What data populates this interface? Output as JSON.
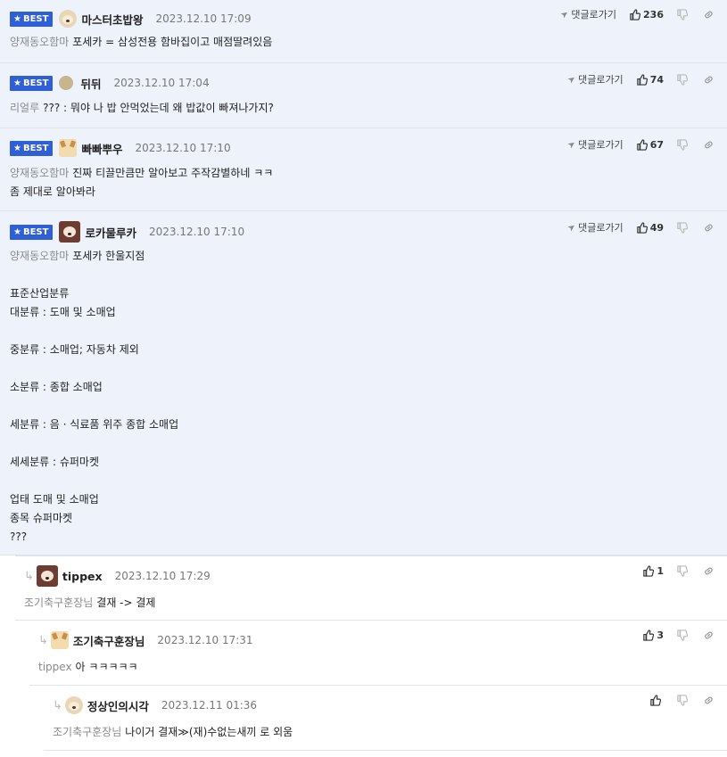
{
  "badge_label": "BEST",
  "action_labels": {
    "goto_reply": "댓글로가기"
  },
  "icons": {
    "goto": "paper-plane-icon",
    "like": "thumbs-up-icon",
    "dislike": "thumbs-down-icon",
    "link": "link-icon",
    "reply": "reply-arrow-icon",
    "best": "star-icon"
  },
  "colors": {
    "best_bg": "#eef2fb",
    "badge_bg": "#2f5fd6",
    "mention": "#8a8a8a"
  },
  "comments": [
    {
      "nick": "마스터초밥왕",
      "date": "2023.12.10 17:09",
      "likes": "236",
      "avatar": "puppy",
      "mention": "양재동오함마",
      "lines": [
        "포세카 = 삼성전용 함바집이고 매점딸려있음"
      ]
    },
    {
      "nick": "뒤뒤",
      "date": "2023.12.10 17:04",
      "likes": "74",
      "avatar": "dot",
      "mention": "리얼루",
      "lines": [
        "??? : 뭐야 나 밥 안먹었는데 왜 밥값이 빠져나가지?"
      ]
    },
    {
      "nick": "빠빠뿌우",
      "date": "2023.12.10 17:10",
      "likes": "67",
      "avatar": "fennec",
      "mention": "양재동오함마",
      "lines": [
        "진짜 티끌만큼만 알아보고 주작감별하네 ㅋㅋ",
        "좀 제대로 알아봐라"
      ]
    },
    {
      "nick": "로카물루카",
      "date": "2023.12.10 17:10",
      "likes": "49",
      "avatar": "mask",
      "mention": "양재동오함마",
      "lines": [
        "포세카 한울지점",
        "",
        "표준산업분류",
        "대분류 : 도매 및 소매업",
        "",
        "중분류 : 소매업; 자동차 제외",
        "",
        "소분류 : 종합 소매업",
        "",
        "세분류 : 음 · 식료품 위주 종합 소매업",
        "",
        "세세분류 : 슈퍼마켓",
        "",
        "업태 도매 및 소매업",
        "종목 슈퍼마켓",
        "???"
      ]
    }
  ],
  "replies": [
    {
      "nick": "tippex",
      "date": "2023.12.10 17:29",
      "likes": "1",
      "avatar": "mask",
      "mention": "조기축구훈장님",
      "text": "결재 -> 결제"
    },
    {
      "nick": "조기축구훈장님",
      "date": "2023.12.10 17:31",
      "likes": "3",
      "avatar": "fennec",
      "mention": "tippex",
      "text": "아 ㅋㅋㅋㅋㅋ"
    },
    {
      "nick": "정상인의시각",
      "date": "2023.12.11 01:36",
      "likes": "",
      "avatar": "puppy",
      "mention": "조기축구훈장님",
      "text": "나이거 결재≫(재)수없는새끼 로 외움"
    }
  ]
}
